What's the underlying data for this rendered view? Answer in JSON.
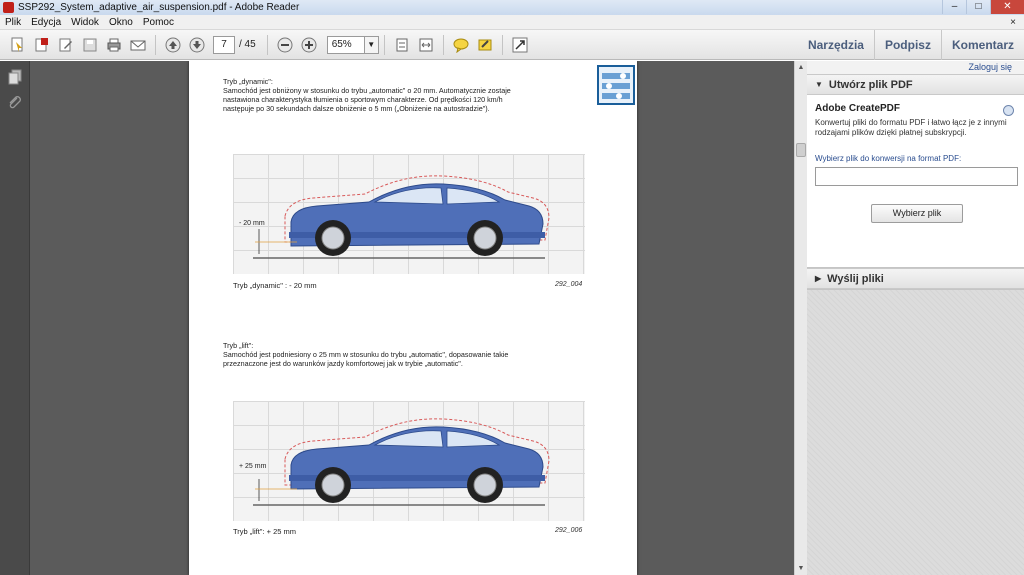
{
  "window": {
    "title": "SSP292_System_adaptive_air_suspension.pdf - Adobe Reader",
    "buttons": {
      "minimize": "‒",
      "maximize": "□",
      "close": "✕"
    }
  },
  "menu": {
    "items": [
      "Plik",
      "Edycja",
      "Widok",
      "Okno",
      "Pomoc"
    ],
    "close_glyph": "×"
  },
  "toolbar": {
    "page_current": "7",
    "page_total": "/ 45",
    "zoom": "65%",
    "right_links": [
      "Narzędzia",
      "Podpisz",
      "Komentarz"
    ]
  },
  "document": {
    "section1": {
      "heading": "Tryb „dynamic\":",
      "lines": [
        "Samochód jest obniżony w stosunku do trybu „automatic\" o 20 mm. Automatycznie zostaje",
        "nastawiona charakterystyka tłumienia o sportowym charakterze. Od prędkości 120 km/h",
        "następuje po 30 sekundach dalsze obniżenie o 5 mm („Obniżenie na autostradzie\")."
      ],
      "dim_label": "- 20 mm",
      "caption": "Tryb „dynamic\" : - 20 mm",
      "code": "292_004"
    },
    "section2": {
      "heading": "Tryb „lift\":",
      "lines": [
        "Samochód jest podniesiony o 25 mm w stosunku do trybu „automatic\", dopasowanie takie",
        "przeznaczone jest do warunków jazdy komfortowej jak w trybie „automatic\"."
      ],
      "dim_label": "+ 25 mm",
      "caption": "Tryb „lift\": + 25 mm",
      "code": "292_006"
    }
  },
  "right_panel": {
    "login": "Zaloguj się",
    "create_pdf": {
      "header": "Utwórz plik PDF",
      "brand": "Adobe CreatePDF",
      "desc": "Konwertuj pliki do formatu PDF i łatwo łącz je z innymi rodzajami plików dzięki płatnej subskrypcji.",
      "prompt": "Wybierz plik do konwersji na format PDF:",
      "input_value": "",
      "button": "Wybierz plik"
    },
    "send_files": {
      "header": "Wyślij pliki"
    }
  },
  "colors": {
    "car_body": "#4f6fb8",
    "dashed_outline": "#d85a5a",
    "accent_link": "#2a4d8f"
  }
}
